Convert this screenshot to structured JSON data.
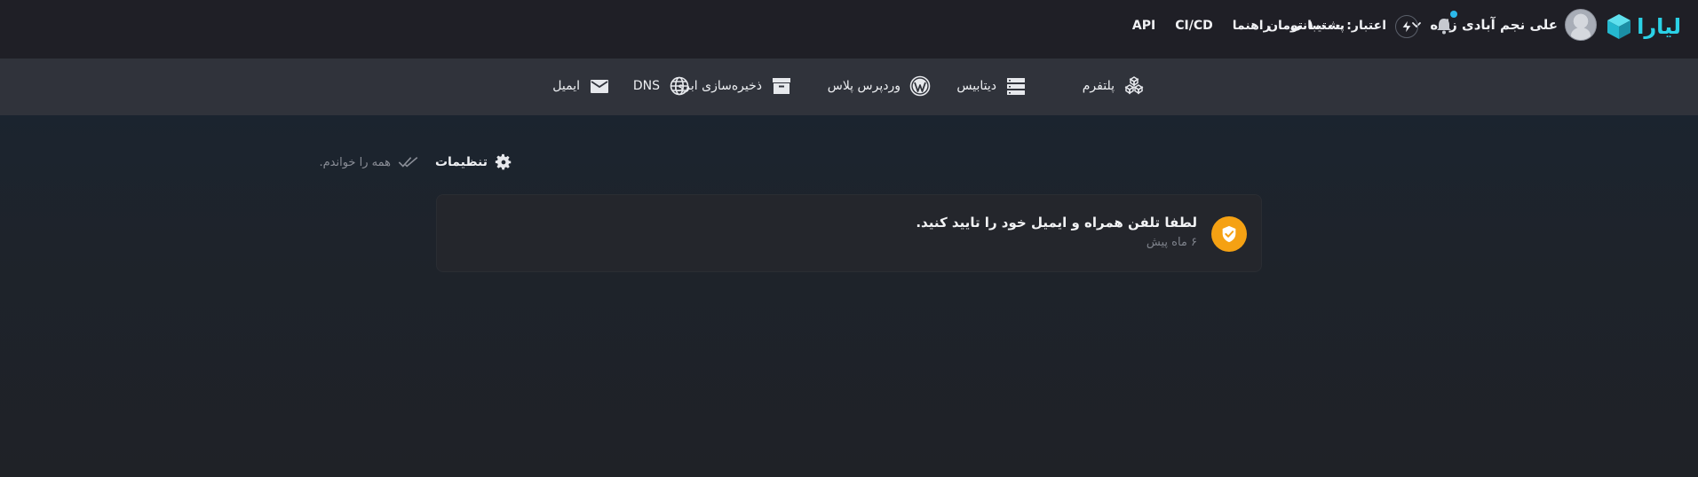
{
  "header": {
    "brand": "لیارا",
    "user_name": "علی نجم آبادی زاده",
    "credit": "اعتبار: ۱،۰۰۰ تومان",
    "nav": [
      "پشتیبانی",
      "راهنما",
      "CI/CD",
      "API"
    ],
    "notification_badge": true
  },
  "services": [
    {
      "label": "پلتفرم",
      "icon": "platform-icon"
    },
    {
      "label": "دیتابیس",
      "icon": "database-icon"
    },
    {
      "label": "وردپرس پلاس",
      "icon": "wordpress-icon"
    },
    {
      "label": "ذخیره‌سازی ابری",
      "icon": "archive-icon"
    },
    {
      "label": "DNS",
      "icon": "globe-icon"
    },
    {
      "label": "ایمیل",
      "icon": "mail-icon"
    }
  ],
  "notifications": {
    "settings_label": "تنظیمات",
    "mark_all_read_label": "همه را خواندم.",
    "items": [
      {
        "title": "لطفا تلفن همراه و ایمیل خود را تایید کنید.",
        "time": "۶ ماه پیش",
        "icon": "shield-check-icon"
      }
    ]
  },
  "colors": {
    "accent": "#2bd1e6",
    "notification_icon_bg": "#f5a113",
    "badge": "#2bb8ea"
  }
}
